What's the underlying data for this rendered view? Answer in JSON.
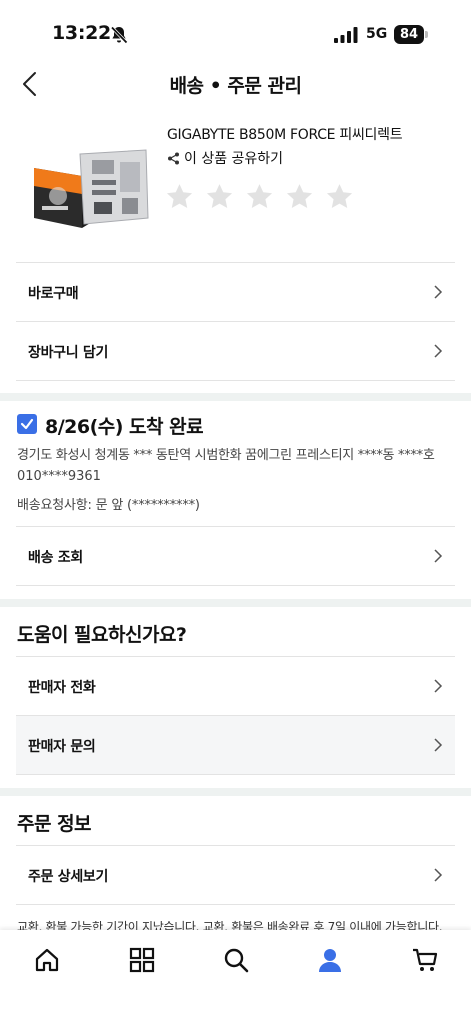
{
  "status_bar": {
    "time": "13:22",
    "network": "5G",
    "battery": "84"
  },
  "header": {
    "title": "배송 • 주문 관리"
  },
  "product": {
    "name": "GIGABYTE B850M FORCE 피씨디렉트",
    "share_label": "이 상품 공유하기",
    "rating": 0,
    "rating_max": 5
  },
  "actions": {
    "buy_now": "바로구매",
    "add_to_cart": "장바구니 담기"
  },
  "delivery": {
    "status": "8/26(수) 도착 완료",
    "address": "경기도 화성시 청계동 *** 동탄역 시범한화 꿈에그린 프레스티지 ****동 ****호",
    "phone": "010****9361",
    "request": "배송요청사항:  문 앞 (**********)",
    "track_label": "배송 조회"
  },
  "help": {
    "heading": "도움이 필요하신가요?",
    "call_seller": "판매자 전화",
    "inquire_seller": "판매자 문의"
  },
  "order_info": {
    "heading": "주문 정보",
    "details_label": "주문 상세보기",
    "notice": "교환, 환불 가능한 기간이 지났습니다. 교환, 환불은 배송완료 후 7일 이내에 가능합니다."
  },
  "tab_bar": {
    "tabs": [
      "home-icon",
      "category-grid-icon",
      "search-icon",
      "my-page-icon",
      "cart-icon"
    ],
    "active": "my-page-icon",
    "active_color": "#3a6fe6"
  }
}
